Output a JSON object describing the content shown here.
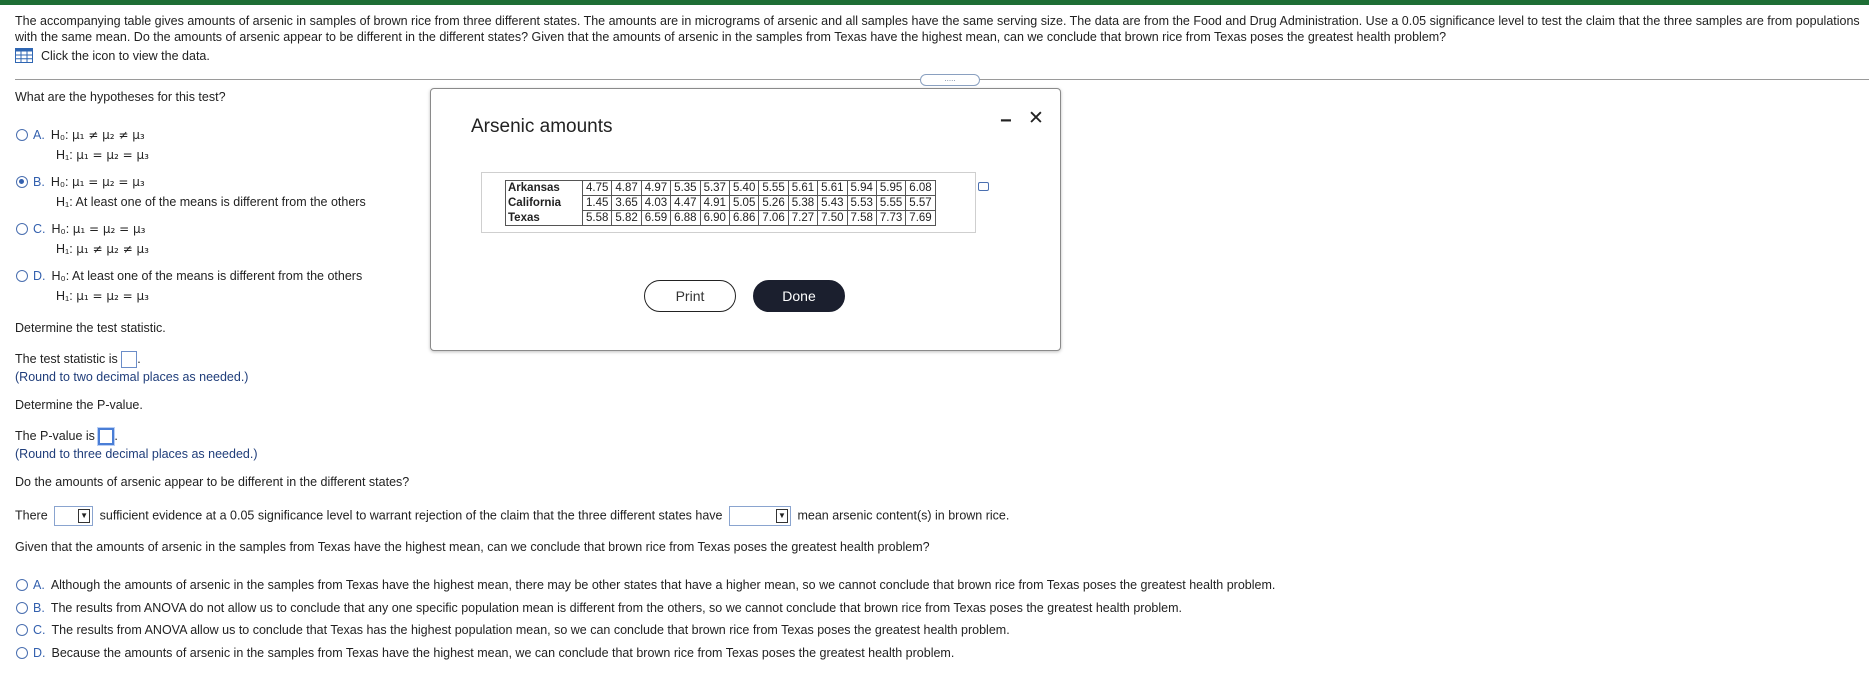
{
  "intro": {
    "text": "The accompanying table gives amounts of arsenic in samples of brown rice from three different states. The amounts are in micrograms of arsenic and all samples have the same serving size. The data are from the Food and Drug Administration. Use a 0.05 significance level to test the claim that the three samples are from populations with the same mean. Do the amounts of arsenic appear to be different in the different states? Given that the amounts of arsenic in the samples from Texas have the highest mean, can we conclude that brown rice from Texas poses the greatest health problem?",
    "data_link": "Click the icon to view the data.",
    "data_icon": "table-grid-icon"
  },
  "hypotheses": {
    "question": "What are the hypotheses for this test?",
    "options": [
      {
        "letter": "A.",
        "h0": "μ₁ ≠ μ₂ ≠ μ₃",
        "h1": "μ₁ = μ₂ = μ₃",
        "selected": false
      },
      {
        "letter": "B.",
        "h0": "μ₁ = μ₂ = μ₃",
        "h1": "At least one of the means is different from the others",
        "selected": true
      },
      {
        "letter": "C.",
        "h0": "μ₁ = μ₂ = μ₃",
        "h1": "μ₁ ≠ μ₂ ≠ μ₃",
        "selected": false
      },
      {
        "letter": "D.",
        "h0": "At least one of the means is different from the others",
        "h1": "μ₁ = μ₂ = μ₃",
        "selected": false
      }
    ],
    "h0_label": "H₀:",
    "h1_label": "H₁:"
  },
  "test_stat": {
    "heading": "Determine the test statistic.",
    "prefix": "The test statistic is",
    "hint": "(Round to two decimal places as needed.)"
  },
  "p_value": {
    "heading": "Determine the P-value.",
    "prefix": "The P-value is",
    "hint": "(Round to three decimal places as needed.)"
  },
  "conclusion": {
    "question": "Do the amounts of arsenic appear to be different in the different states?",
    "part1": "There",
    "part2": "sufficient evidence at a",
    "alpha": "0.05",
    "part3": "significance level to warrant rejection of the claim that the three different states have",
    "part4": "mean arsenic content(s) in brown rice."
  },
  "final": {
    "question": "Given that the amounts of arsenic in the samples from Texas have the highest mean, can we conclude that brown rice from Texas poses the greatest health problem?",
    "options": [
      {
        "letter": "A.",
        "text": "Although the amounts of arsenic in the samples from Texas have the highest mean, there may be other states that have a higher mean, so we cannot conclude that brown rice from Texas poses the greatest health problem."
      },
      {
        "letter": "B.",
        "text": "The results from ANOVA do not allow us to conclude that any one specific population mean is different from the others, so we cannot conclude that brown rice from Texas poses the greatest health problem."
      },
      {
        "letter": "C.",
        "text": "The results from ANOVA allow us to conclude that Texas has the highest population mean, so we can conclude that brown rice from Texas poses the greatest health problem."
      },
      {
        "letter": "D.",
        "text": "Because the amounts of arsenic in the samples from Texas have the highest mean, we can conclude that brown rice from Texas poses the greatest health problem."
      }
    ]
  },
  "modal": {
    "title": "Arsenic amounts",
    "minimize": "−",
    "close": "✕",
    "handle": ".....",
    "print_label": "Print",
    "done_label": "Done",
    "table": [
      {
        "state": "Arkansas",
        "values": [
          "4.75",
          "4.87",
          "4.97",
          "5.35",
          "5.37",
          "5.40",
          "5.55",
          "5.61",
          "5.61",
          "5.94",
          "5.95",
          "6.08"
        ]
      },
      {
        "state": "California",
        "values": [
          "1.45",
          "3.65",
          "4.03",
          "4.47",
          "4.91",
          "5.05",
          "5.26",
          "5.38",
          "5.43",
          "5.53",
          "5.55",
          "5.57"
        ]
      },
      {
        "state": "Texas",
        "values": [
          "5.58",
          "5.82",
          "6.59",
          "6.88",
          "6.90",
          "6.86",
          "7.06",
          "7.27",
          "7.50",
          "7.58",
          "7.73",
          "7.69"
        ]
      }
    ]
  }
}
